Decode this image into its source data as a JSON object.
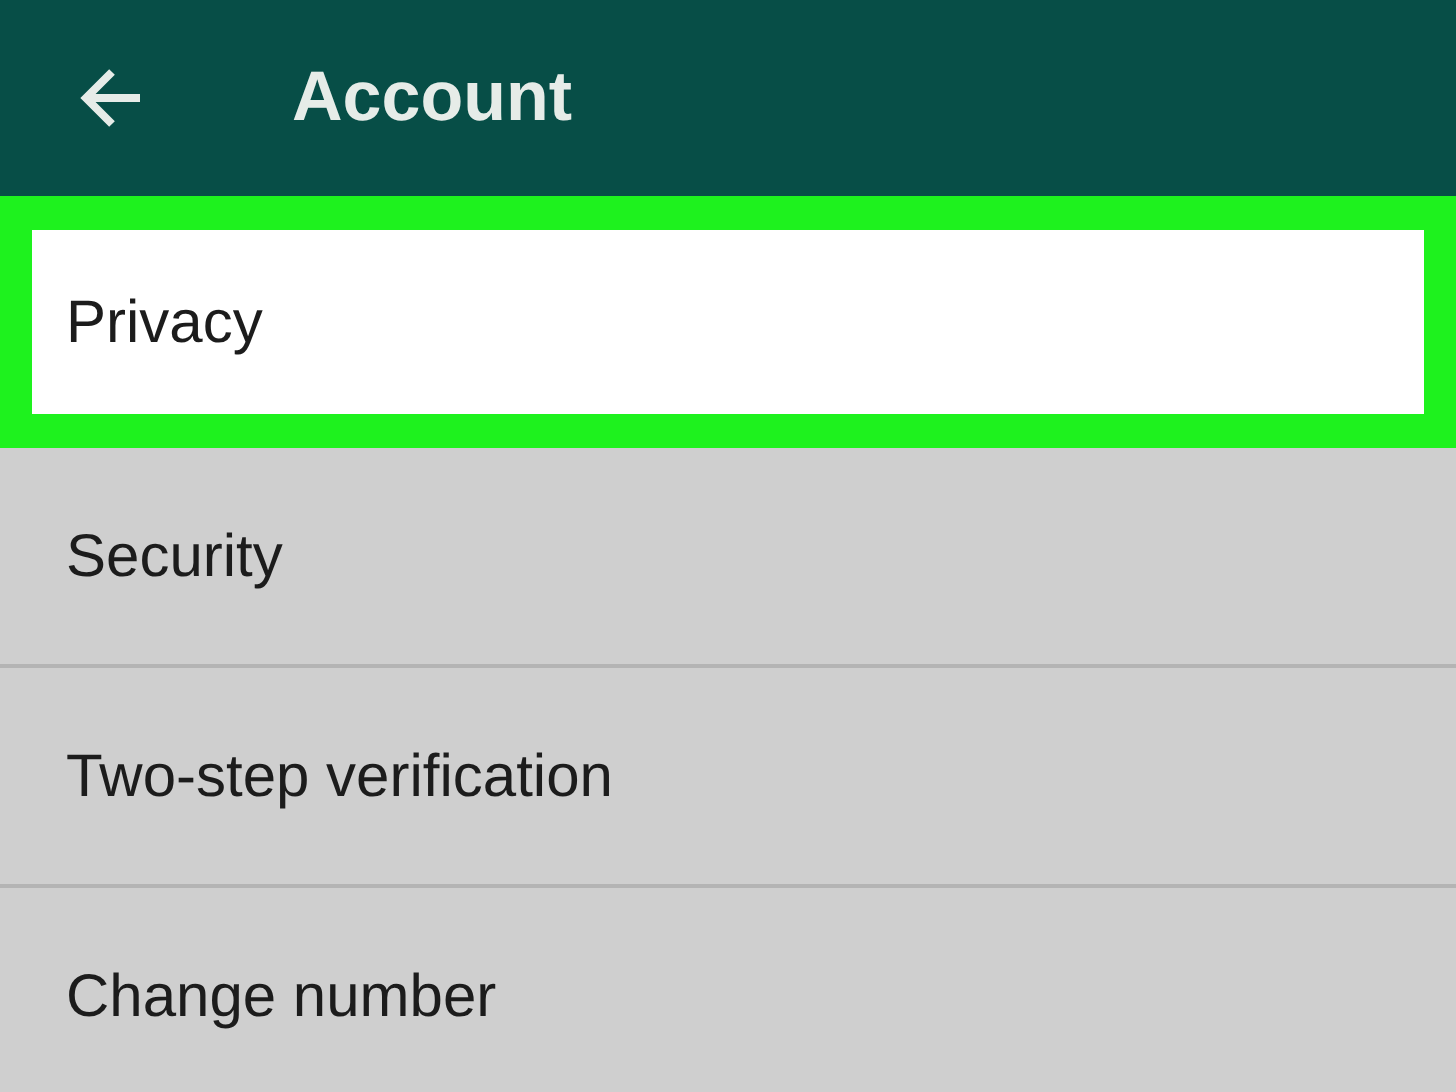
{
  "app_bar": {
    "title": "Account"
  },
  "items": [
    {
      "label": "Privacy",
      "selected": true
    },
    {
      "label": "Security",
      "selected": false
    },
    {
      "label": "Two-step verification",
      "selected": false
    },
    {
      "label": "Change number",
      "selected": false
    }
  ]
}
